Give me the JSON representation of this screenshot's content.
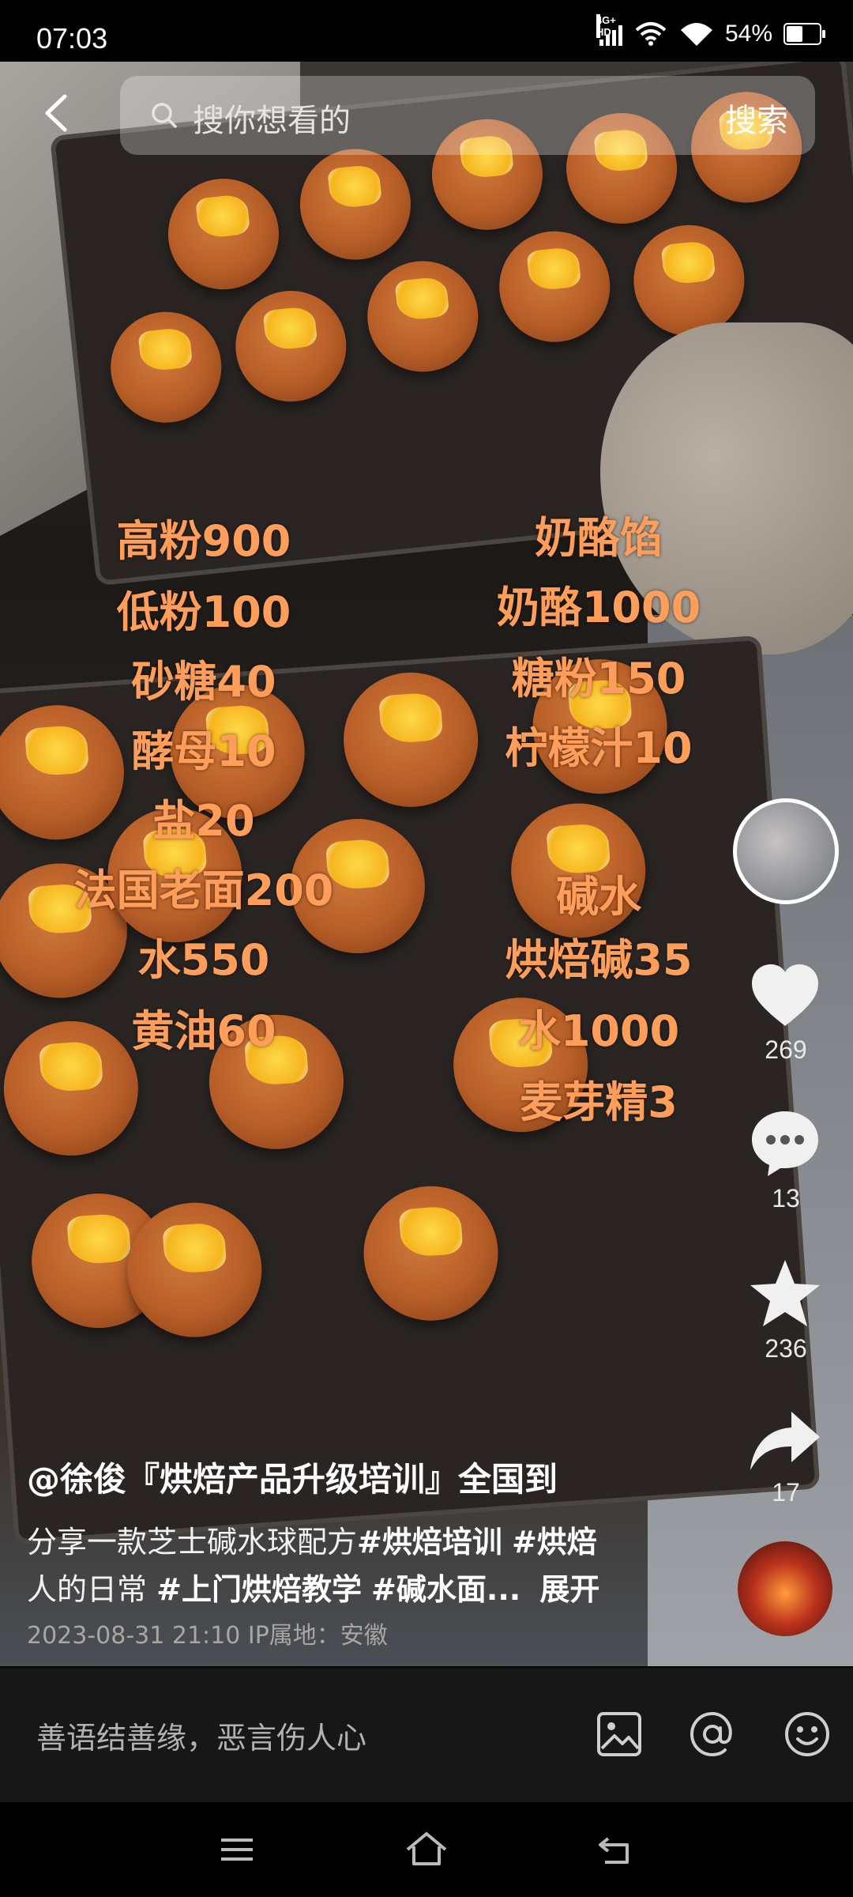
{
  "status_bar": {
    "time": "07:03",
    "network": "4G+ HD",
    "battery_percent": "54%",
    "battery_level": 0.54
  },
  "search": {
    "placeholder": "搜你想看的",
    "button_label": "搜索"
  },
  "recipe_overlay": {
    "left": [
      "高粉900",
      "低粉100",
      "砂糖40",
      "酵母10",
      "盐20",
      "法国老面200",
      "水550",
      "黄油60"
    ],
    "right": [
      "奶酪馅",
      "奶酪1000",
      "糖粉150",
      "柠檬汁10",
      "碱水",
      "烘焙碱35",
      "水1000",
      "麦芽精3"
    ]
  },
  "actions": {
    "likes": "269",
    "comments": "13",
    "favorites": "236",
    "shares": "17"
  },
  "caption": {
    "author": "@徐俊『烘焙产品升级培训』全国到",
    "line1_text": "分享一款芝士碱水球配方",
    "tag1": "#烘焙培训",
    "tag2": "#烘焙",
    "line2_text": "人的日常",
    "tag3": "#上门烘焙教学",
    "tag4": "#碱水面...",
    "expand": "展开",
    "meta": "2023-08-31 21:10  IP属地：安徽"
  },
  "comment_bar": {
    "placeholder": "善语结善缘，恶言伤人心"
  },
  "icons": {
    "back": "chevron-left-icon",
    "search": "search-icon",
    "like": "heart-icon",
    "comment": "comment-bubble-icon",
    "favorite": "star-icon",
    "share": "share-arrow-icon",
    "image": "image-icon",
    "mention": "at-icon",
    "emoji": "smiley-icon"
  },
  "colors": {
    "recipe_text": "#ff9d5a",
    "comment_bar_bg": "#171717"
  }
}
